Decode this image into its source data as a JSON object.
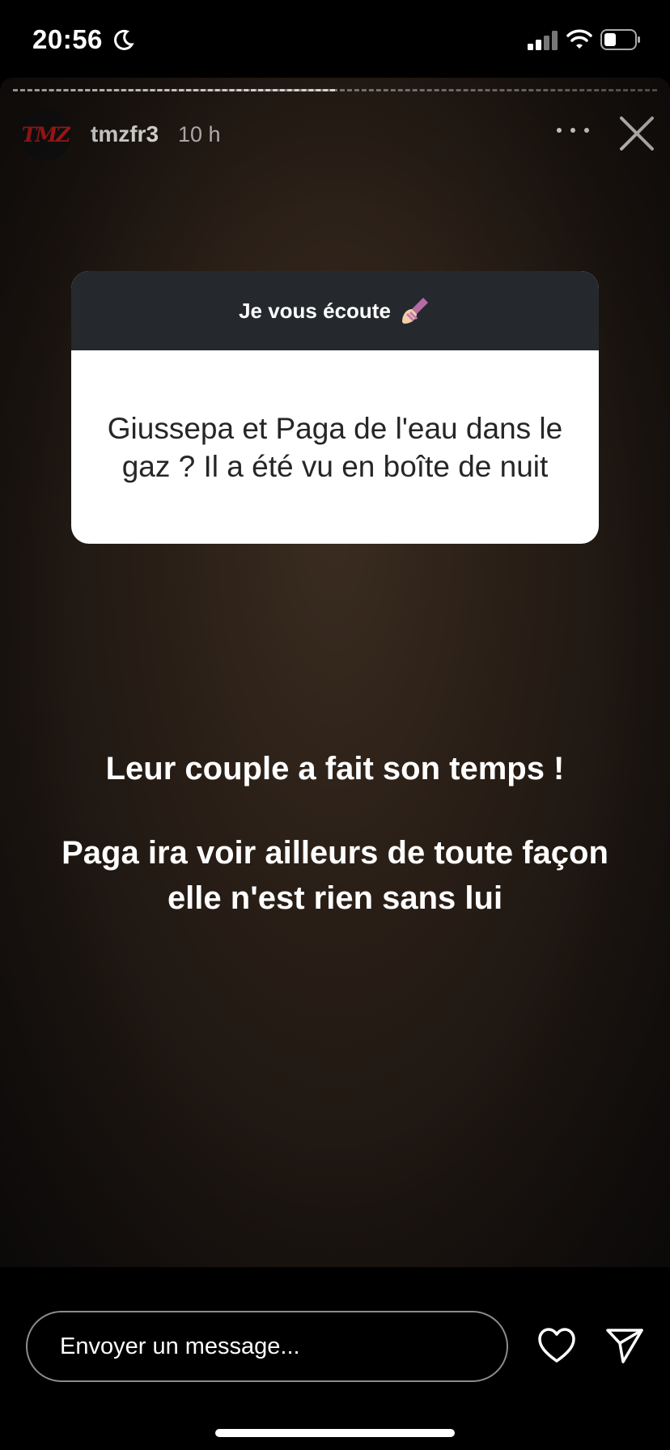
{
  "status_bar": {
    "time": "20:56",
    "icons": [
      "moon-icon",
      "signal-icon",
      "wifi-icon",
      "battery-icon"
    ]
  },
  "story": {
    "progress_fraction": 0.5,
    "username": "tmzfr3",
    "time_ago": "10 h",
    "avatar_logo": "TMZ",
    "question": {
      "header": "Je vous écoute",
      "header_emoji": "nail-polish-icon",
      "text": "Giussepa et Paga de l'eau dans le gaz ? Il a été vu en boîte de nuit"
    },
    "answer_line_1": "Leur couple a fait son temps !",
    "answer_line_2": "Paga ira voir ailleurs de toute façon elle n'est rien sans lui"
  },
  "bottom_bar": {
    "message_placeholder": "Envoyer un message..."
  },
  "colors": {
    "question_header_bg": "#25292d",
    "logo_red": "#d9201d"
  }
}
